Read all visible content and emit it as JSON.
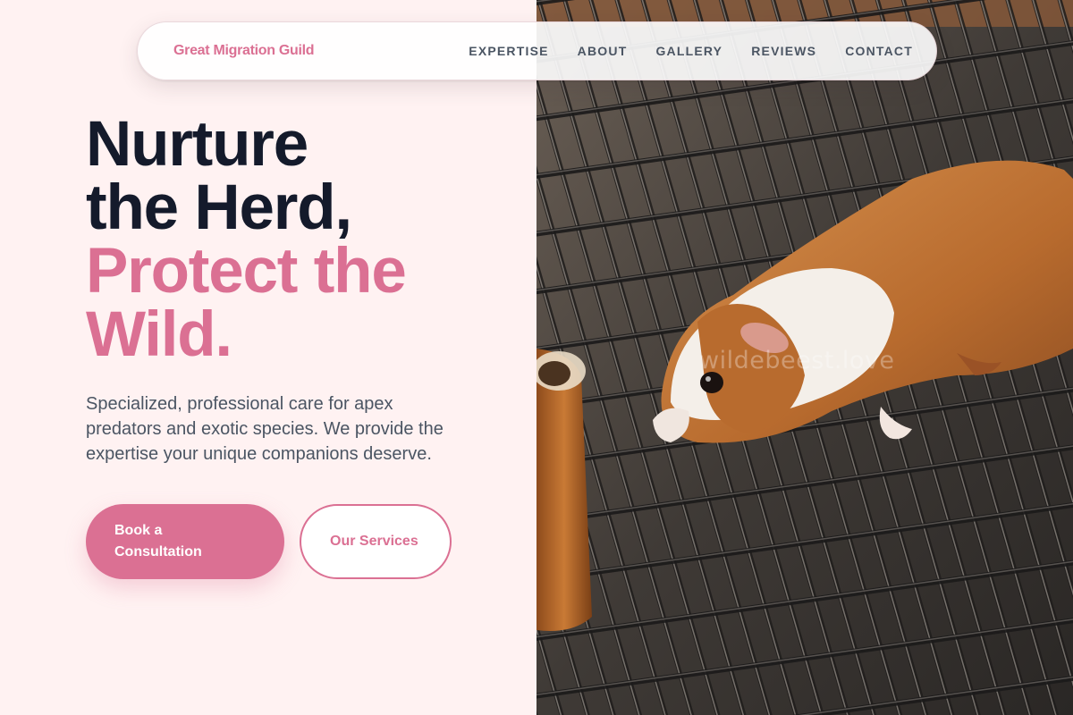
{
  "nav": {
    "brand": "Great Migration Guild",
    "links": [
      {
        "label": "EXPERTISE"
      },
      {
        "label": "ABOUT"
      },
      {
        "label": "GALLERY"
      },
      {
        "label": "REVIEWS"
      },
      {
        "label": "CONTACT"
      }
    ]
  },
  "hero": {
    "headline_line1": "Nurture",
    "headline_line2": "the Herd,",
    "headline_line3": "Protect the",
    "headline_line4": "Wild.",
    "lead": "Specialized, professional care for apex predators and exotic species. We provide the expertise your unique companions deserve.",
    "primary_button": "Book a Consultation",
    "secondary_button": "Our Services"
  },
  "image": {
    "watermark": "wildebeest.love",
    "subject": "guinea pig on wire grate"
  },
  "colors": {
    "accent": "#db7093",
    "heading": "#141a2b",
    "body_text": "#4b5563",
    "background": "#fff2f2"
  }
}
